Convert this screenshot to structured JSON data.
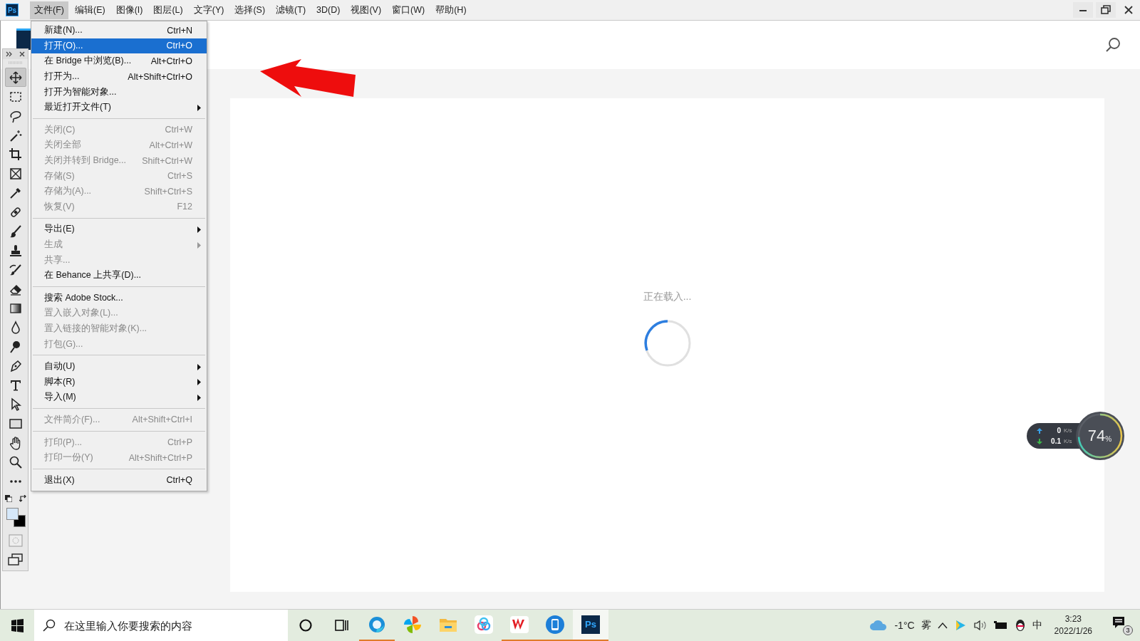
{
  "menubar": {
    "app_logo": "Ps",
    "menus": [
      {
        "label": "文件(F)",
        "selected": true
      },
      {
        "label": "编辑(E)",
        "selected": false
      },
      {
        "label": "图像(I)",
        "selected": false
      },
      {
        "label": "图层(L)",
        "selected": false
      },
      {
        "label": "文字(Y)",
        "selected": false
      },
      {
        "label": "选择(S)",
        "selected": false
      },
      {
        "label": "滤镜(T)",
        "selected": false
      },
      {
        "label": "3D(D)",
        "selected": false
      },
      {
        "label": "视图(V)",
        "selected": false
      },
      {
        "label": "窗口(W)",
        "selected": false
      },
      {
        "label": "帮助(H)",
        "selected": false
      }
    ]
  },
  "file_menu": [
    {
      "kind": "item",
      "label": "新建(N)...",
      "shortcut": "Ctrl+N",
      "disabled": false,
      "selected": false
    },
    {
      "kind": "item",
      "label": "打开(O)...",
      "shortcut": "Ctrl+O",
      "disabled": false,
      "selected": true
    },
    {
      "kind": "item",
      "label": "在 Bridge 中浏览(B)...",
      "shortcut": "Alt+Ctrl+O",
      "disabled": false,
      "selected": false
    },
    {
      "kind": "item",
      "label": "打开为...",
      "shortcut": "Alt+Shift+Ctrl+O",
      "disabled": false,
      "selected": false
    },
    {
      "kind": "item",
      "label": "打开为智能对象...",
      "disabled": false,
      "selected": false
    },
    {
      "kind": "submenu",
      "label": "最近打开文件(T)",
      "disabled": false,
      "selected": false
    },
    {
      "kind": "separator"
    },
    {
      "kind": "item",
      "label": "关闭(C)",
      "shortcut": "Ctrl+W",
      "disabled": true,
      "selected": false
    },
    {
      "kind": "item",
      "label": "关闭全部",
      "shortcut": "Alt+Ctrl+W",
      "disabled": true,
      "selected": false
    },
    {
      "kind": "item",
      "label": "关闭并转到 Bridge...",
      "shortcut": "Shift+Ctrl+W",
      "disabled": true,
      "selected": false
    },
    {
      "kind": "item",
      "label": "存储(S)",
      "shortcut": "Ctrl+S",
      "disabled": true,
      "selected": false
    },
    {
      "kind": "item",
      "label": "存储为(A)...",
      "shortcut": "Shift+Ctrl+S",
      "disabled": true,
      "selected": false
    },
    {
      "kind": "item",
      "label": "恢复(V)",
      "shortcut": "F12",
      "disabled": true,
      "selected": false
    },
    {
      "kind": "separator"
    },
    {
      "kind": "submenu",
      "label": "导出(E)",
      "disabled": false,
      "selected": false
    },
    {
      "kind": "submenu",
      "label": "生成",
      "disabled": true,
      "selected": false
    },
    {
      "kind": "item",
      "label": "共享...",
      "disabled": true,
      "selected": false
    },
    {
      "kind": "item",
      "label": "在 Behance 上共享(D)...",
      "disabled": false,
      "selected": false
    },
    {
      "kind": "separator"
    },
    {
      "kind": "item",
      "label": "搜索 Adobe Stock...",
      "disabled": false,
      "selected": false
    },
    {
      "kind": "item",
      "label": "置入嵌入对象(L)...",
      "disabled": true,
      "selected": false
    },
    {
      "kind": "item",
      "label": "置入链接的智能对象(K)...",
      "disabled": true,
      "selected": false
    },
    {
      "kind": "item",
      "label": "打包(G)...",
      "disabled": true,
      "selected": false
    },
    {
      "kind": "separator"
    },
    {
      "kind": "submenu",
      "label": "自动(U)",
      "disabled": false,
      "selected": false
    },
    {
      "kind": "submenu",
      "label": "脚本(R)",
      "disabled": false,
      "selected": false
    },
    {
      "kind": "submenu",
      "label": "导入(M)",
      "disabled": false,
      "selected": false
    },
    {
      "kind": "separator"
    },
    {
      "kind": "item",
      "label": "文件简介(F)...",
      "shortcut": "Alt+Shift+Ctrl+I",
      "disabled": true,
      "selected": false
    },
    {
      "kind": "separator"
    },
    {
      "kind": "item",
      "label": "打印(P)...",
      "shortcut": "Ctrl+P",
      "disabled": true,
      "selected": false
    },
    {
      "kind": "item",
      "label": "打印一份(Y)",
      "shortcut": "Alt+Shift+Ctrl+P",
      "disabled": true,
      "selected": false
    },
    {
      "kind": "separator"
    },
    {
      "kind": "item",
      "label": "退出(X)",
      "shortcut": "Ctrl+Q",
      "disabled": false,
      "selected": false
    }
  ],
  "tools": [
    {
      "kind": "move",
      "selected": true
    },
    {
      "kind": "marquee",
      "selected": false
    },
    {
      "kind": "lasso",
      "selected": false
    },
    {
      "kind": "wand",
      "selected": false
    },
    {
      "kind": "crop",
      "selected": false
    },
    {
      "kind": "frame",
      "selected": false
    },
    {
      "kind": "eyedropper",
      "selected": false
    },
    {
      "kind": "healing",
      "selected": false
    },
    {
      "kind": "brush",
      "selected": false
    },
    {
      "kind": "stamp",
      "selected": false
    },
    {
      "kind": "history",
      "selected": false
    },
    {
      "kind": "eraser",
      "selected": false
    },
    {
      "kind": "gradient",
      "selected": false
    },
    {
      "kind": "blur",
      "selected": false
    },
    {
      "kind": "dodge",
      "selected": false
    },
    {
      "kind": "pen",
      "selected": false
    },
    {
      "kind": "type",
      "selected": false
    },
    {
      "kind": "select",
      "selected": false
    },
    {
      "kind": "rectangle",
      "selected": false
    },
    {
      "kind": "hand",
      "selected": false
    },
    {
      "kind": "zoom",
      "selected": false
    },
    {
      "kind": "more",
      "selected": false
    }
  ],
  "canvas": {
    "loading_text": "正在载入..."
  },
  "network_widget": {
    "upload": "0",
    "upload_unit": "K/s",
    "download": "0.1",
    "download_unit": "K/s",
    "percent": "74",
    "percent_sign": "%"
  },
  "taskbar": {
    "search_placeholder": "在这里输入你要搜索的内容",
    "apps": [
      {
        "kind": "edge",
        "running": true,
        "active": false
      },
      {
        "kind": "pinwheel",
        "running": false,
        "active": false
      },
      {
        "kind": "folder",
        "running": false,
        "active": false
      },
      {
        "kind": "cloud",
        "running": false,
        "active": false
      },
      {
        "kind": "wps",
        "running": true,
        "active": false
      },
      {
        "kind": "phone",
        "running": true,
        "active": false
      },
      {
        "kind": "ps",
        "label": "Ps",
        "running": true,
        "active": true
      }
    ],
    "weather_temp": "-1°C",
    "weather_text": "雾",
    "ime": "中",
    "time": "3:23",
    "date": "2022/1/26",
    "notifications": "3"
  }
}
